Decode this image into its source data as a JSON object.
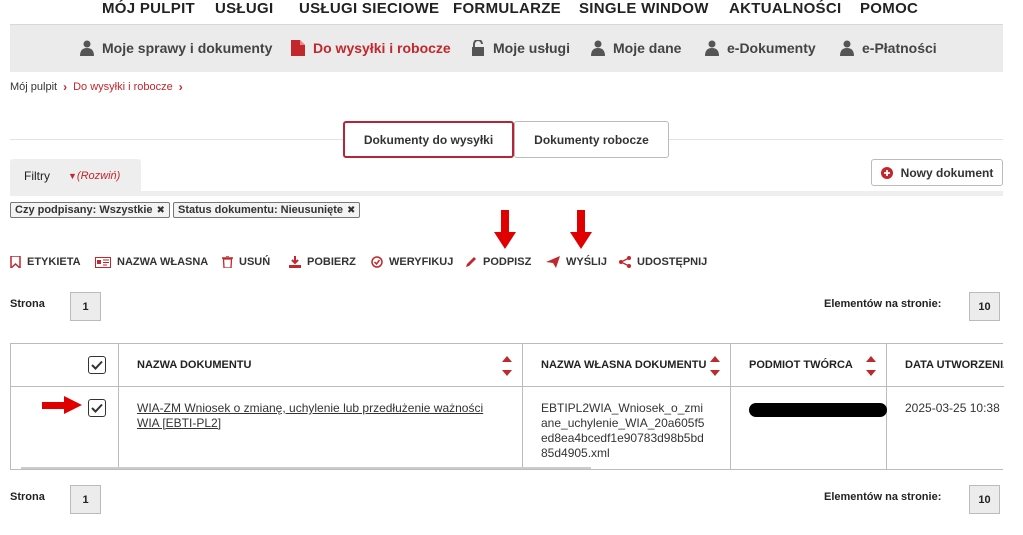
{
  "topnav": [
    "MÓJ PULPIT",
    "USŁUGI",
    "USŁUGI SIECIOWE",
    "FORMULARZE",
    "SINGLE WINDOW",
    "AKTUALNOŚCI",
    "POMOC"
  ],
  "subnav": [
    {
      "label": "Moje sprawy i dokumenty",
      "icon": "user-icon",
      "active": false
    },
    {
      "label": "Do wysyłki i robocze",
      "icon": "document-icon",
      "active": true
    },
    {
      "label": "Moje usługi",
      "icon": "unlock-icon",
      "active": false
    },
    {
      "label": "Moje dane",
      "icon": "user-icon",
      "active": false
    },
    {
      "label": "e-Dokumenty",
      "icon": "user-icon",
      "active": false
    },
    {
      "label": "e-Płatności",
      "icon": "user-icon",
      "active": false
    }
  ],
  "breadcrumb": {
    "root": "Mój pulpit",
    "current": "Do wysyłki i robocze"
  },
  "tabs": {
    "send": "Dokumenty do wysyłki",
    "draft": "Dokumenty robocze"
  },
  "filters": {
    "label": "Filtry",
    "expand": "(Rozwiń)",
    "chips": [
      "Czy podpisany: Wszystkie",
      "Status dokumentu: Nieusunięte"
    ]
  },
  "new_document": "Nowy dokument",
  "actions": [
    "ETYKIETA",
    "NAZWA WŁASNA",
    "USUŃ",
    "POBIERZ",
    "WERYFIKUJ",
    "PODPISZ",
    "WYŚLIJ",
    "UDOSTĘPNIJ"
  ],
  "pager": {
    "page_label": "Strona",
    "page": "1",
    "per_page_label": "Elementów na stronie:",
    "per_page": "10"
  },
  "table": {
    "headers": [
      "NAZWA DOKUMENTU",
      "NAZWA WŁASNA DOKUMENTU",
      "PODMIOT TWÓRCA",
      "DATA UTWORZENIA"
    ],
    "row": {
      "name": "WIA-ZM Wniosek o zmianę, uchylenie lub przedłużenie ważności WIA [EBTI-PL2]",
      "own_name": "EBTIPL2WIA_Wniosek_o_zmiane_uchylenie_WIA_20a605f5ed8ea4bcedf1e90783d98b5bd85d4905.xml",
      "date": "2025-03-25 10:38"
    }
  },
  "colors": {
    "accent": "#c1272d",
    "arrow": "#e00000"
  }
}
